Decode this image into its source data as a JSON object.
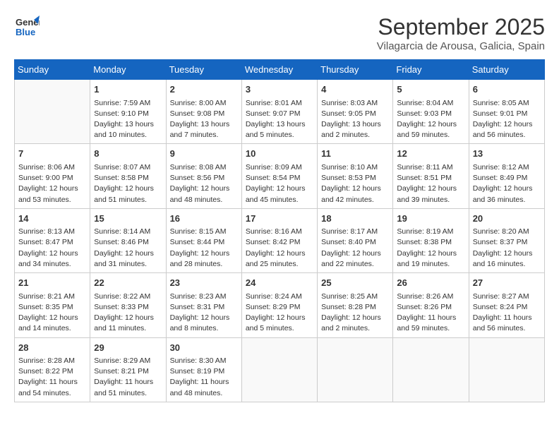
{
  "logo": {
    "line1": "General",
    "line2": "Blue"
  },
  "title": "September 2025",
  "location": "Vilagarcia de Arousa, Galicia, Spain",
  "days_of_week": [
    "Sunday",
    "Monday",
    "Tuesday",
    "Wednesday",
    "Thursday",
    "Friday",
    "Saturday"
  ],
  "weeks": [
    [
      {
        "day": "",
        "text": ""
      },
      {
        "day": "1",
        "text": "Sunrise: 7:59 AM\nSunset: 9:10 PM\nDaylight: 13 hours\nand 10 minutes."
      },
      {
        "day": "2",
        "text": "Sunrise: 8:00 AM\nSunset: 9:08 PM\nDaylight: 13 hours\nand 7 minutes."
      },
      {
        "day": "3",
        "text": "Sunrise: 8:01 AM\nSunset: 9:07 PM\nDaylight: 13 hours\nand 5 minutes."
      },
      {
        "day": "4",
        "text": "Sunrise: 8:03 AM\nSunset: 9:05 PM\nDaylight: 13 hours\nand 2 minutes."
      },
      {
        "day": "5",
        "text": "Sunrise: 8:04 AM\nSunset: 9:03 PM\nDaylight: 12 hours\nand 59 minutes."
      },
      {
        "day": "6",
        "text": "Sunrise: 8:05 AM\nSunset: 9:01 PM\nDaylight: 12 hours\nand 56 minutes."
      }
    ],
    [
      {
        "day": "7",
        "text": "Sunrise: 8:06 AM\nSunset: 9:00 PM\nDaylight: 12 hours\nand 53 minutes."
      },
      {
        "day": "8",
        "text": "Sunrise: 8:07 AM\nSunset: 8:58 PM\nDaylight: 12 hours\nand 51 minutes."
      },
      {
        "day": "9",
        "text": "Sunrise: 8:08 AM\nSunset: 8:56 PM\nDaylight: 12 hours\nand 48 minutes."
      },
      {
        "day": "10",
        "text": "Sunrise: 8:09 AM\nSunset: 8:54 PM\nDaylight: 12 hours\nand 45 minutes."
      },
      {
        "day": "11",
        "text": "Sunrise: 8:10 AM\nSunset: 8:53 PM\nDaylight: 12 hours\nand 42 minutes."
      },
      {
        "day": "12",
        "text": "Sunrise: 8:11 AM\nSunset: 8:51 PM\nDaylight: 12 hours\nand 39 minutes."
      },
      {
        "day": "13",
        "text": "Sunrise: 8:12 AM\nSunset: 8:49 PM\nDaylight: 12 hours\nand 36 minutes."
      }
    ],
    [
      {
        "day": "14",
        "text": "Sunrise: 8:13 AM\nSunset: 8:47 PM\nDaylight: 12 hours\nand 34 minutes."
      },
      {
        "day": "15",
        "text": "Sunrise: 8:14 AM\nSunset: 8:46 PM\nDaylight: 12 hours\nand 31 minutes."
      },
      {
        "day": "16",
        "text": "Sunrise: 8:15 AM\nSunset: 8:44 PM\nDaylight: 12 hours\nand 28 minutes."
      },
      {
        "day": "17",
        "text": "Sunrise: 8:16 AM\nSunset: 8:42 PM\nDaylight: 12 hours\nand 25 minutes."
      },
      {
        "day": "18",
        "text": "Sunrise: 8:17 AM\nSunset: 8:40 PM\nDaylight: 12 hours\nand 22 minutes."
      },
      {
        "day": "19",
        "text": "Sunrise: 8:19 AM\nSunset: 8:38 PM\nDaylight: 12 hours\nand 19 minutes."
      },
      {
        "day": "20",
        "text": "Sunrise: 8:20 AM\nSunset: 8:37 PM\nDaylight: 12 hours\nand 16 minutes."
      }
    ],
    [
      {
        "day": "21",
        "text": "Sunrise: 8:21 AM\nSunset: 8:35 PM\nDaylight: 12 hours\nand 14 minutes."
      },
      {
        "day": "22",
        "text": "Sunrise: 8:22 AM\nSunset: 8:33 PM\nDaylight: 12 hours\nand 11 minutes."
      },
      {
        "day": "23",
        "text": "Sunrise: 8:23 AM\nSunset: 8:31 PM\nDaylight: 12 hours\nand 8 minutes."
      },
      {
        "day": "24",
        "text": "Sunrise: 8:24 AM\nSunset: 8:29 PM\nDaylight: 12 hours\nand 5 minutes."
      },
      {
        "day": "25",
        "text": "Sunrise: 8:25 AM\nSunset: 8:28 PM\nDaylight: 12 hours\nand 2 minutes."
      },
      {
        "day": "26",
        "text": "Sunrise: 8:26 AM\nSunset: 8:26 PM\nDaylight: 11 hours\nand 59 minutes."
      },
      {
        "day": "27",
        "text": "Sunrise: 8:27 AM\nSunset: 8:24 PM\nDaylight: 11 hours\nand 56 minutes."
      }
    ],
    [
      {
        "day": "28",
        "text": "Sunrise: 8:28 AM\nSunset: 8:22 PM\nDaylight: 11 hours\nand 54 minutes."
      },
      {
        "day": "29",
        "text": "Sunrise: 8:29 AM\nSunset: 8:21 PM\nDaylight: 11 hours\nand 51 minutes."
      },
      {
        "day": "30",
        "text": "Sunrise: 8:30 AM\nSunset: 8:19 PM\nDaylight: 11 hours\nand 48 minutes."
      },
      {
        "day": "",
        "text": ""
      },
      {
        "day": "",
        "text": ""
      },
      {
        "day": "",
        "text": ""
      },
      {
        "day": "",
        "text": ""
      }
    ]
  ]
}
